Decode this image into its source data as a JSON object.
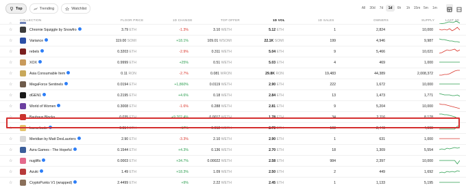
{
  "tabs": [
    {
      "label": "Top",
      "icon": "trophy-icon",
      "active": true
    },
    {
      "label": "Trending",
      "icon": "trending-icon",
      "active": false
    },
    {
      "label": "Watchlist",
      "icon": "star-icon",
      "active": false
    }
  ],
  "ranges": [
    "All",
    "30d",
    "7d",
    "1d",
    "6h",
    "1h",
    "15m",
    "5m",
    "1m"
  ],
  "active_range": "1d",
  "columns": {
    "collection": "COLLECTION",
    "floor": "FLOOR PRICE",
    "floor_change": "1D CHANGE",
    "top_offer": "TOP OFFER",
    "volume": "1D VOL",
    "sales": "1D SALES",
    "owners": "OWNERS",
    "supply": "SUPPLY",
    "last": "LAST 1D"
  },
  "rows": [
    {
      "name": "Chromie Squiggle by Snowfro",
      "verified": true,
      "floor": "3.79",
      "floor_unit": "ETH",
      "change": "-1.3%",
      "dir": "neg",
      "offer": "3.10",
      "offer_unit": "WETH",
      "vol": "5.12",
      "vol_unit": "ETH",
      "sales": "1",
      "owners": "2,824",
      "supply": "10,000",
      "thumb": "#3b3b3b",
      "spark": [
        6,
        5,
        6,
        5,
        7,
        4,
        6,
        9,
        5
      ]
    },
    {
      "name": "Variance",
      "verified": true,
      "floor": "119.00",
      "floor_unit": "SOMI",
      "change": "+18.1%",
      "dir": "pos",
      "offer": "109.01",
      "offer_unit": "WSOMI",
      "vol": "22.1K",
      "vol_unit": "SOMI",
      "sales": "199",
      "owners": "4,946",
      "supply": "9,987",
      "thumb": "#2b4fa6",
      "spark": [
        8,
        7,
        7,
        6,
        5,
        5,
        4,
        4,
        3
      ]
    },
    {
      "name": "rebels",
      "verified": true,
      "floor": "0.3203",
      "floor_unit": "ETH",
      "change": "-2.9%",
      "dir": "neg",
      "offer": "0.311",
      "offer_unit": "WETH",
      "vol": "5.04",
      "vol_unit": "ETH",
      "sales": "9",
      "owners": "5,466",
      "supply": "10,021",
      "thumb": "#7a1f1f",
      "spark": [
        3,
        4,
        6,
        8,
        7,
        8,
        9,
        6,
        8
      ]
    },
    {
      "name": "XOX",
      "verified": true,
      "floor": "0.9999",
      "floor_unit": "ETH",
      "change": "+25%",
      "dir": "pos",
      "offer": "0.51",
      "offer_unit": "WETH",
      "vol": "5.03",
      "vol_unit": "ETH",
      "sales": "4",
      "owners": "469",
      "supply": "1,000",
      "thumb": "#c89a5b",
      "spark": [
        6,
        6,
        6,
        6,
        6,
        6,
        6,
        6,
        6
      ]
    },
    {
      "name": "Asia Consumable Item",
      "verified": true,
      "floor": "0.11",
      "floor_unit": "RON",
      "change": "-2.7%",
      "dir": "neg",
      "offer": "0.081",
      "offer_unit": "WRON",
      "vol": "29.8K",
      "vol_unit": "RON",
      "sales": "19,483",
      "owners": "44,389",
      "supply": "2,008,372",
      "thumb": "#c8a85a",
      "spark": [
        3,
        3,
        4,
        4,
        5,
        7,
        9,
        10,
        10
      ]
    },
    {
      "name": "MegaForce Sentinels",
      "verified": true,
      "floor": "0.0194",
      "floor_unit": "ETH",
      "change": "+1,860%",
      "dir": "pos",
      "offer": "0.0119",
      "offer_unit": "WETH",
      "vol": "2.90",
      "vol_unit": "ETH",
      "sales": "222",
      "owners": "1,672",
      "supply": "10,000",
      "thumb": "#6d5a4a",
      "spark": [
        6,
        6,
        6,
        6,
        6,
        6,
        6,
        6,
        6
      ]
    },
    {
      "name": "dGEN1",
      "verified": true,
      "floor": "0.2195",
      "floor_unit": "ETH",
      "change": "+4.6%",
      "dir": "pos",
      "offer": "0.18",
      "offer_unit": "WETH",
      "vol": "2.84",
      "vol_unit": "ETH",
      "sales": "13",
      "owners": "1,473",
      "supply": "1,771",
      "thumb": "#1a1a1a",
      "spark": [
        8,
        7,
        6,
        6,
        6,
        5,
        5,
        6,
        4
      ]
    },
    {
      "name": "World of Women",
      "verified": true,
      "floor": "0.3008",
      "floor_unit": "ETH",
      "change": "-1.6%",
      "dir": "neg",
      "offer": "0.288",
      "offer_unit": "WETH",
      "vol": "2.81",
      "vol_unit": "ETH",
      "sales": "9",
      "owners": "5,204",
      "supply": "10,000",
      "thumb": "#6b3fa0",
      "spark": [
        9,
        8,
        8,
        7,
        6,
        5,
        4,
        3,
        2
      ]
    },
    {
      "name": "Bauhaus Blocks",
      "verified": false,
      "floor": "0.035",
      "floor_unit": "ETH",
      "change": "+9,702.4%",
      "dir": "pos",
      "offer": "0.0017",
      "offer_unit": "WETH",
      "vol": "1.78",
      "vol_unit": "ETH",
      "sales": "34",
      "owners": "2,116",
      "supply": "8,178",
      "thumb": "#c8342d",
      "spark": [
        10,
        10,
        9,
        9,
        8,
        7,
        6,
        4,
        2
      ]
    },
    {
      "name": "Lama Lads",
      "verified": true,
      "floor": "0.014",
      "floor_unit": "ETH",
      "change": "+17%",
      "dir": "pos",
      "offer": "0.012",
      "offer_unit": "WETH",
      "vol": "2.73",
      "vol_unit": "ETH",
      "sales": "198",
      "owners": "2,446",
      "supply": "4,969",
      "thumb": "#e3c36a",
      "spark": [
        4,
        4,
        4,
        4,
        4,
        4,
        4,
        8,
        9
      ]
    },
    {
      "name": "Meridian by Matt DesLauriers",
      "verified": true,
      "floor": "2.90",
      "floor_unit": "ETH",
      "change": "-3.3%",
      "dir": "neg",
      "offer": "2.10",
      "offer_unit": "WETH",
      "vol": "2.90",
      "vol_unit": "ETH",
      "sales": "1",
      "owners": "631",
      "supply": "1,000",
      "thumb": "#d8d8d8",
      "spark": [
        6,
        6,
        6,
        6,
        6,
        6,
        6,
        6,
        6
      ]
    },
    {
      "name": "Azra Games - The Hopeful",
      "verified": true,
      "floor": "0.1544",
      "floor_unit": "ETH",
      "change": "+4.3%",
      "dir": "pos",
      "offer": "0.136",
      "offer_unit": "WETH",
      "vol": "2.70",
      "vol_unit": "ETH",
      "sales": "18",
      "owners": "1,309",
      "supply": "5,554",
      "thumb": "#3b5e9a",
      "spark": [
        6,
        7,
        6,
        8,
        7,
        8,
        9,
        8,
        9
      ]
    },
    {
      "name": "nuglifts",
      "verified": true,
      "floor": "0.0003",
      "floor_unit": "ETH",
      "change": "+34.7%",
      "dir": "pos",
      "offer": "0.00022",
      "offer_unit": "WETH",
      "vol": "2.58",
      "vol_unit": "ETH",
      "sales": "984",
      "owners": "2,397",
      "supply": "10,000",
      "thumb": "#e46a8c",
      "spark": [
        6,
        6,
        6,
        6,
        6,
        6,
        6,
        1,
        6
      ]
    },
    {
      "name": "Azuki",
      "verified": true,
      "floor": "1.49",
      "floor_unit": "ETH",
      "change": "+18.3%",
      "dir": "pos",
      "offer": "1.09",
      "offer_unit": "WETH",
      "vol": "2.50",
      "vol_unit": "ETH",
      "sales": "2",
      "owners": "449",
      "supply": "1,692",
      "thumb": "#b73a3a",
      "spark": [
        4,
        5,
        4,
        6,
        5,
        6,
        5,
        7,
        6
      ]
    },
    {
      "name": "CryptoPunks V1 (wrapped)",
      "verified": true,
      "floor": "2.4499",
      "floor_unit": "ETH",
      "change": "+9%",
      "dir": "pos",
      "offer": "2.22",
      "offer_unit": "WETH",
      "vol": "2.45",
      "vol_unit": "ETH",
      "sales": "1",
      "owners": "1,133",
      "supply": "5,195",
      "thumb": "#8a6f5a",
      "spark": [
        6,
        6,
        6,
        6,
        6,
        6,
        6,
        6,
        6
      ]
    }
  ],
  "colors": {
    "positive": "#2a9d4e",
    "negative": "#d9352b",
    "highlight": "#d42d2d",
    "verified": "#2d7ef7"
  }
}
